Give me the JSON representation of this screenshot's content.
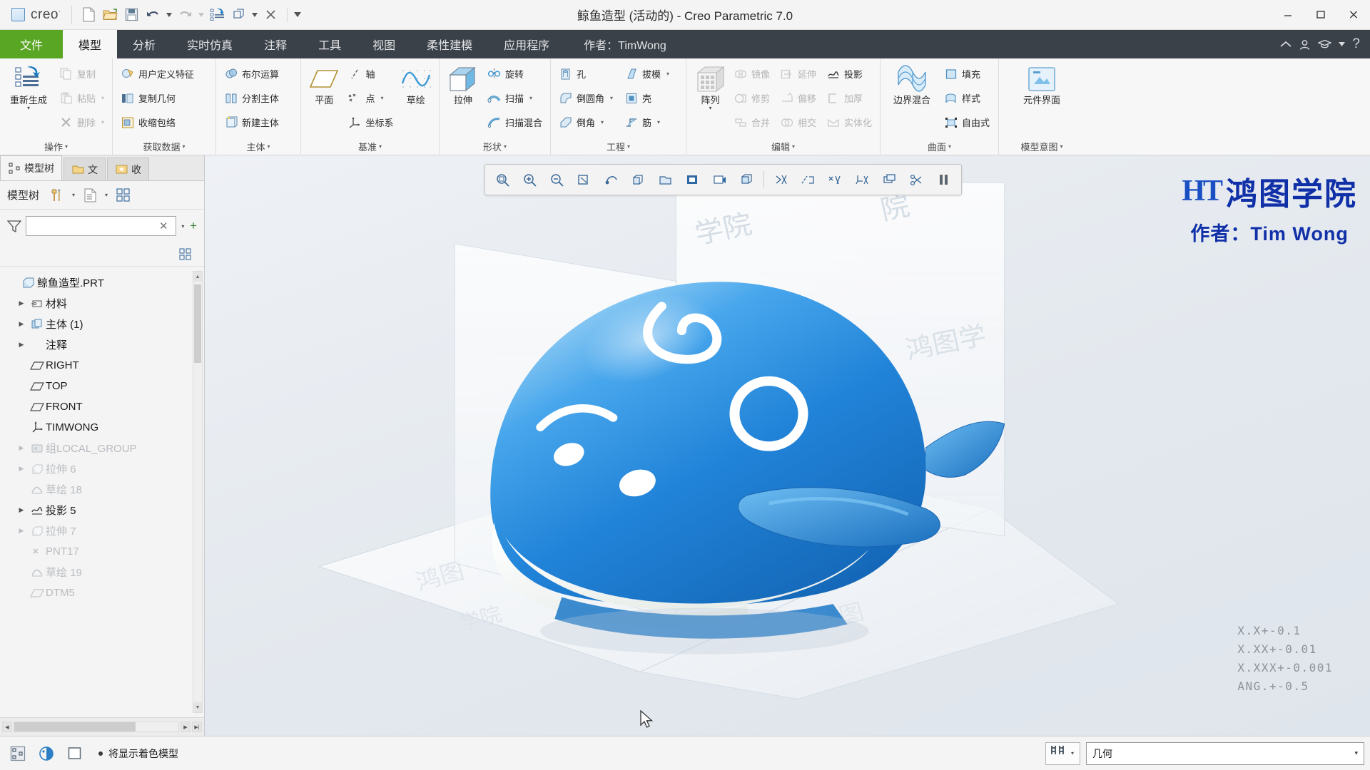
{
  "window": {
    "title": "鲸鱼造型 (活动的) - Creo Parametric 7.0",
    "app_name": "creo",
    "minimize": "–",
    "maximize": "□",
    "close": "✕"
  },
  "quick_access": [
    {
      "name": "new-file",
      "label": "新建"
    },
    {
      "name": "open-file",
      "label": "打开"
    },
    {
      "name": "save-file",
      "label": "保存"
    },
    {
      "name": "undo",
      "label": "撤消"
    },
    {
      "name": "undo-dropdown",
      "label": "▾"
    },
    {
      "name": "redo",
      "label": "重做"
    },
    {
      "name": "redo-dropdown",
      "label": "▾"
    },
    {
      "name": "regenerate",
      "label": "重新生成"
    },
    {
      "name": "repaint",
      "label": "重画"
    },
    {
      "name": "repaint-dropdown",
      "label": "▾"
    },
    {
      "name": "close-window",
      "label": "关闭"
    },
    {
      "name": "customize-dropdown",
      "label": "▾"
    }
  ],
  "tabs": [
    {
      "id": "file",
      "label": "文件",
      "active": false,
      "style": "file"
    },
    {
      "id": "model",
      "label": "模型",
      "active": true,
      "style": "normal"
    },
    {
      "id": "analyze",
      "label": "分析",
      "active": false,
      "style": "normal"
    },
    {
      "id": "sim",
      "label": "实时仿真",
      "active": false,
      "style": "normal"
    },
    {
      "id": "annot",
      "label": "注释",
      "active": false,
      "style": "normal"
    },
    {
      "id": "tools",
      "label": "工具",
      "active": false,
      "style": "normal"
    },
    {
      "id": "view",
      "label": "视图",
      "active": false,
      "style": "normal"
    },
    {
      "id": "flex",
      "label": "柔性建模",
      "active": false,
      "style": "normal"
    },
    {
      "id": "apps",
      "label": "应用程序",
      "active": false,
      "style": "normal"
    },
    {
      "id": "author",
      "label": "作者：TimWong",
      "active": false,
      "style": "author"
    }
  ],
  "ribbon": {
    "groups": [
      {
        "id": "operations",
        "label": "操作",
        "big": {
          "label": "重新生成",
          "icon": "regenerate-icon",
          "caret": "▾"
        },
        "items": [
          {
            "label": "复制",
            "icon": "copy-icon",
            "disabled": true,
            "caret": ""
          },
          {
            "label": "粘贴",
            "icon": "paste-icon",
            "disabled": true,
            "caret": "▾"
          },
          {
            "label": "删除",
            "icon": "delete-icon",
            "disabled": true,
            "caret": "▾"
          }
        ]
      },
      {
        "id": "get-data",
        "label": "获取数据",
        "items": [
          {
            "label": "用户定义特征",
            "icon": "udf-icon",
            "disabled": false,
            "caret": ""
          },
          {
            "label": "复制几何",
            "icon": "copy-geom-icon",
            "disabled": false,
            "caret": ""
          },
          {
            "label": "收缩包络",
            "icon": "shrinkwrap-icon",
            "disabled": false,
            "caret": ""
          }
        ]
      },
      {
        "id": "body",
        "label": "主体",
        "items": [
          {
            "label": "布尔运算",
            "icon": "boolean-icon",
            "disabled": false,
            "caret": ""
          },
          {
            "label": "分割主体",
            "icon": "split-body-icon",
            "disabled": false,
            "caret": ""
          },
          {
            "label": "新建主体",
            "icon": "new-body-icon",
            "disabled": false,
            "caret": ""
          }
        ]
      },
      {
        "id": "datum",
        "label": "基准",
        "big": {
          "label": "平面",
          "icon": "plane-icon",
          "caret": ""
        },
        "big2": {
          "label": "草绘",
          "icon": "sketch-icon",
          "caret": ""
        },
        "items": [
          {
            "label": "轴",
            "icon": "axis-icon",
            "disabled": false,
            "caret": ""
          },
          {
            "label": "点",
            "icon": "point-icon",
            "disabled": false,
            "caret": "▾"
          },
          {
            "label": "坐标系",
            "icon": "csys-icon",
            "disabled": false,
            "caret": ""
          }
        ]
      },
      {
        "id": "shapes",
        "label": "形状",
        "big": {
          "label": "拉伸",
          "icon": "extrude-icon",
          "caret": ""
        },
        "items": [
          {
            "label": "旋转",
            "icon": "revolve-icon",
            "disabled": false,
            "caret": ""
          },
          {
            "label": "扫描",
            "icon": "sweep-icon",
            "disabled": false,
            "caret": "▾"
          },
          {
            "label": "扫描混合",
            "icon": "sweep-blend-icon",
            "disabled": false,
            "caret": ""
          }
        ]
      },
      {
        "id": "engineering",
        "label": "工程",
        "items": [
          {
            "label": "孔",
            "icon": "hole-icon",
            "disabled": false,
            "caret": ""
          },
          {
            "label": "倒圆角",
            "icon": "round-icon",
            "disabled": false,
            "caret": "▾"
          },
          {
            "label": "倒角",
            "icon": "chamfer-icon",
            "disabled": false,
            "caret": "▾"
          }
        ],
        "items2": [
          {
            "label": "拔模",
            "icon": "draft-icon",
            "disabled": false,
            "caret": "▾"
          },
          {
            "label": "壳",
            "icon": "shell-icon",
            "disabled": false,
            "caret": ""
          },
          {
            "label": "筋",
            "icon": "rib-icon",
            "disabled": false,
            "caret": "▾"
          }
        ]
      },
      {
        "id": "editing",
        "label": "编辑",
        "big": {
          "label": "阵列",
          "icon": "pattern-icon",
          "caret": "▾"
        },
        "items": [
          {
            "label": "镜像",
            "icon": "mirror-icon",
            "disabled": true,
            "caret": ""
          },
          {
            "label": "修剪",
            "icon": "trim-icon",
            "disabled": true,
            "caret": ""
          },
          {
            "label": "合并",
            "icon": "merge-icon",
            "disabled": true,
            "caret": ""
          }
        ],
        "items2": [
          {
            "label": "延伸",
            "icon": "extend-icon",
            "disabled": true,
            "caret": ""
          },
          {
            "label": "偏移",
            "icon": "offset-icon",
            "disabled": true,
            "caret": ""
          },
          {
            "label": "相交",
            "icon": "intersect-icon",
            "disabled": true,
            "caret": ""
          }
        ],
        "items3": [
          {
            "label": "投影",
            "icon": "project-icon",
            "disabled": false,
            "caret": ""
          },
          {
            "label": "加厚",
            "icon": "thicken-icon",
            "disabled": true,
            "caret": ""
          },
          {
            "label": "实体化",
            "icon": "solidify-icon",
            "disabled": true,
            "caret": ""
          }
        ]
      },
      {
        "id": "surfaces",
        "label": "曲面",
        "big": {
          "label": "边界混合",
          "icon": "boundary-blend-icon",
          "caret": ""
        },
        "items": [
          {
            "label": "填充",
            "icon": "fill-icon",
            "disabled": false,
            "caret": ""
          },
          {
            "label": "样式",
            "icon": "style-icon",
            "disabled": false,
            "caret": ""
          },
          {
            "label": "自由式",
            "icon": "freestyle-icon",
            "disabled": false,
            "caret": ""
          }
        ]
      },
      {
        "id": "model-intent",
        "label": "模型意图",
        "big": {
          "label": "元件界面",
          "icon": "component-interface-icon",
          "caret": ""
        },
        "items": []
      }
    ]
  },
  "left_panel": {
    "tabs": [
      {
        "id": "model-tree",
        "label": "模型树",
        "icon": "model-tree-icon",
        "active": true
      },
      {
        "id": "folder",
        "label": "文",
        "icon": "folder-icon",
        "active": false
      },
      {
        "id": "favorites",
        "label": "收",
        "icon": "favorites-icon",
        "active": false
      }
    ],
    "toolbar_title": "模型树",
    "toolbar_buttons": [
      {
        "name": "settings-tools-icon",
        "caret": "▾"
      },
      {
        "name": "display-list-icon",
        "caret": "▾"
      },
      {
        "name": "tree-columns-icon",
        "caret": ""
      }
    ],
    "filter": {
      "value": "",
      "placeholder": "",
      "clear": "✕",
      "dropdown": "▾",
      "add": "+"
    },
    "tree": [
      {
        "label": "鲸鱼造型.PRT",
        "icon": "part-icon",
        "arrow": "",
        "indent": 0,
        "dim": false
      },
      {
        "label": "材料",
        "icon": "material-icon",
        "arrow": "▶",
        "indent": 1,
        "dim": false
      },
      {
        "label": "主体 (1)",
        "icon": "bodies-icon",
        "arrow": "▶",
        "indent": 1,
        "dim": false
      },
      {
        "label": "注释",
        "icon": "",
        "arrow": "▶",
        "indent": 1,
        "dim": false
      },
      {
        "label": "RIGHT",
        "icon": "plane-icon",
        "arrow": "",
        "indent": 1,
        "dim": false
      },
      {
        "label": "TOP",
        "icon": "plane-icon",
        "arrow": "",
        "indent": 1,
        "dim": false
      },
      {
        "label": "FRONT",
        "icon": "plane-icon",
        "arrow": "",
        "indent": 1,
        "dim": false
      },
      {
        "label": "TIMWONG",
        "icon": "csys-icon",
        "arrow": "",
        "indent": 1,
        "dim": false
      },
      {
        "label": "组LOCAL_GROUP",
        "icon": "group-icon",
        "arrow": "▶",
        "indent": 1,
        "dim": true
      },
      {
        "label": "拉伸 6",
        "icon": "extrude-icon",
        "arrow": "▶",
        "indent": 1,
        "dim": true
      },
      {
        "label": "草绘 18",
        "icon": "sketch-icon",
        "arrow": "",
        "indent": 1,
        "dim": true
      },
      {
        "label": "投影 5",
        "icon": "project-icon",
        "arrow": "▶",
        "indent": 1,
        "dim": false
      },
      {
        "label": "拉伸 7",
        "icon": "extrude-icon",
        "arrow": "▶",
        "indent": 1,
        "dim": true
      },
      {
        "label": "PNT17",
        "icon": "point-icon",
        "arrow": "",
        "indent": 1,
        "dim": true
      },
      {
        "label": "草绘 19",
        "icon": "sketch-icon",
        "arrow": "",
        "indent": 1,
        "dim": true
      },
      {
        "label": "DTM5",
        "icon": "plane-icon",
        "arrow": "",
        "indent": 1,
        "dim": true
      }
    ]
  },
  "viewport_toolbar": [
    {
      "name": "refit-zoom-icon"
    },
    {
      "name": "zoom-in-icon"
    },
    {
      "name": "zoom-out-icon"
    },
    {
      "name": "repaint-icon"
    },
    {
      "name": "spin-center-icon"
    },
    {
      "name": "view-orientation-icon"
    },
    {
      "name": "saved-views-icon"
    },
    {
      "name": "datum-display-icon"
    },
    {
      "name": "annotation-display-icon"
    },
    {
      "name": "display-style-icon"
    },
    {
      "name": "plane-tag-display-icon"
    },
    {
      "name": "axis-tag-display-icon"
    },
    {
      "name": "point-tag-display-icon"
    },
    {
      "name": "csys-tag-display-icon"
    },
    {
      "name": "layer-display-icon"
    },
    {
      "name": "cross-section-icon"
    },
    {
      "name": "pause-playback-icon"
    }
  ],
  "watermark": {
    "logo_initials": "HT",
    "logo_text": "鸿图学院",
    "subtitle": "作者：Tim Wong"
  },
  "tolerance_note": [
    "X.X+-0.1",
    "X.XX+-0.01",
    "X.XXX+-0.001",
    "ANG.+-0.5"
  ],
  "status_bar": {
    "icons": [
      {
        "name": "model-tree-toggle-icon"
      },
      {
        "name": "appearance-gallery-icon"
      },
      {
        "name": "display-style-icon"
      }
    ],
    "message": "将显示着色模型",
    "filter_button": {
      "name": "selection-filter-icon",
      "caret": "▾"
    },
    "select_value": "几何",
    "select_caret": "▾"
  },
  "colors": {
    "file_tab_green": "#59a524",
    "tab_bar_dark": "#3b4149",
    "active_tab_bg": "#f7f7f7",
    "ribbon_bg": "#f7f7f7",
    "viewport_bg": "#e8ecf1",
    "watermark_blue": "#1030a8",
    "model_blue": "#2f8fdd",
    "disabled_text": "#b4b4b4"
  }
}
